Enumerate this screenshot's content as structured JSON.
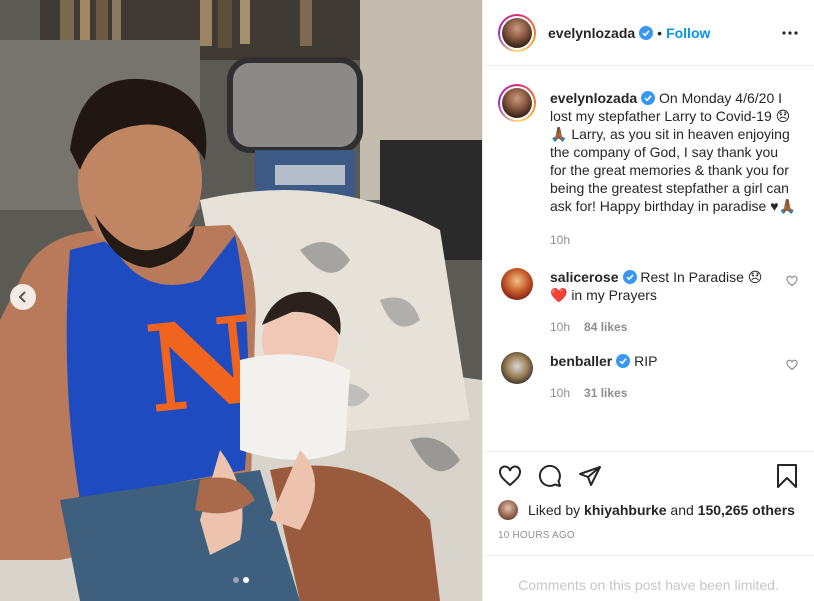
{
  "header": {
    "username": "evelynlozada",
    "separator": "•",
    "follow_label": "Follow"
  },
  "caption": {
    "username": "evelynlozada",
    "text": "On Monday 4/6/20 I lost my stepfather Larry to Covid-19 😞🙏🏾 Larry, as you sit in heaven enjoying the company of God, I say thank you for the great memories & thank you for being the greatest stepfather a girl can ask for! Happy birthday in paradise ♥🙏🏾",
    "time": "10h"
  },
  "comments": [
    {
      "username": "salicerose",
      "text": "Rest In Paradise 😞 ❤️ in my Prayers",
      "time": "10h",
      "likes": "84 likes"
    },
    {
      "username": "benballer",
      "text": "RIP",
      "time": "10h",
      "likes": "31 likes"
    }
  ],
  "liked_by": {
    "prefix": "Liked by",
    "user": "khiyahburke",
    "middle": "and",
    "count": "150,265 others"
  },
  "post_time": "10 HOURS AGO",
  "comments_limited": "Comments on this post have been limited.",
  "carousel": {
    "total": 2,
    "active": 2
  },
  "icons": {
    "verified": "verified-badge-icon",
    "more": "more-options-icon",
    "like": "heart-icon",
    "comment": "comment-icon",
    "share": "share-icon",
    "save": "bookmark-icon",
    "prev": "chevron-left-icon"
  },
  "colors": {
    "accent": "#0095f6",
    "text": "#262626",
    "muted": "#8e8e8e",
    "verified": "#3897f0"
  }
}
